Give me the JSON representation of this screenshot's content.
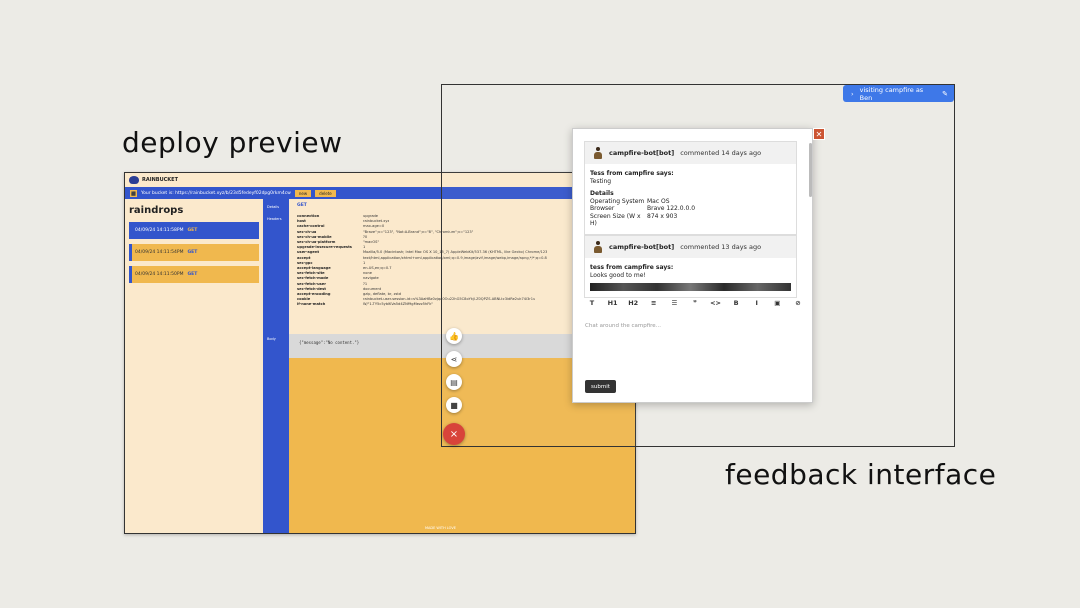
{
  "captions": {
    "deploy": "deploy preview",
    "feedback": "feedback interface"
  },
  "deploy": {
    "brand": "RAINBUCKET",
    "bucket_text": "Your bucket is: https://rainbucket.xyz/b/23d5fedeyf02dpg0rkm4cw",
    "buttons": [
      "new",
      "delete"
    ],
    "title": "raindrops",
    "requests": [
      {
        "time": "04/09/24 14:11:58PM",
        "method": "GET",
        "selected": true
      },
      {
        "time": "04/09/24 14:11:54PM",
        "method": "GET",
        "selected": false
      },
      {
        "time": "04/09/24 14:11:50PM",
        "method": "GET",
        "selected": false
      }
    ],
    "labels": {
      "details": "Details",
      "headers": "Headers",
      "body": "Body"
    },
    "method": "GET",
    "headers": [
      {
        "k": "connection",
        "v": "upgrade"
      },
      {
        "k": "host",
        "v": "rainbucket.xyz"
      },
      {
        "k": "cache-control",
        "v": "max-age=0"
      },
      {
        "k": "sec-ch-ua",
        "v": "\"Brave\";v=\"123\", \"Not:A-Brand\";v=\"8\", \"Chromium\";v=\"123\""
      },
      {
        "k": "sec-ch-ua-mobile",
        "v": "?0"
      },
      {
        "k": "sec-ch-ua-platform",
        "v": "\"macOS\""
      },
      {
        "k": "upgrade-insecure-requests",
        "v": "1"
      },
      {
        "k": "user-agent",
        "v": "Mozilla/5.0 (Macintosh; Intel Mac OS X 10_15_7) AppleWebKit/537.36 (KHTML, like Gecko) Chrome/123"
      },
      {
        "k": "accept",
        "v": "text/html,application/xhtml+xml,application/xml;q=0.9,image/avif,image/webp,image/apng,*/*;q=0.8"
      },
      {
        "k": "sec-gpc",
        "v": "1"
      },
      {
        "k": "accept-language",
        "v": "en-US,en;q=0.7"
      },
      {
        "k": "sec-fetch-site",
        "v": "none"
      },
      {
        "k": "sec-fetch-mode",
        "v": "navigate"
      },
      {
        "k": "sec-fetch-user",
        "v": "?1"
      },
      {
        "k": "sec-fetch-dest",
        "v": "document"
      },
      {
        "k": "accept-encoding",
        "v": "gzip, deflate, br, zstd"
      },
      {
        "k": "cookie",
        "v": "rainbucket-user-session-id=s%3AaHBz0vjqa0Ou22hG5C8oYkjl.Z0QPZS.ABNLtc3idRe2uk74i3r1u"
      },
      {
        "k": "if-none-match",
        "v": "W/\"1-TY5c5yblKVa5d4ZNf9gMezz5hFk\""
      }
    ],
    "body": "{\"message\":\"No content.\"}",
    "footer": "MADE WITH LOVE"
  },
  "feedback": {
    "visiting": "visiting campfire as Ben",
    "comments": [
      {
        "author": "campfire-bot[bot]",
        "when": "commented 14 days ago",
        "says": "Tess from campfire says:",
        "text": "Testing",
        "details_title": "Details",
        "details": [
          {
            "k": "Operating System",
            "v": "Mac OS"
          },
          {
            "k": "Browser",
            "v": "Brave 122.0.0.0"
          },
          {
            "k": "Screen Size (W x H)",
            "v": "874 x 903"
          }
        ]
      },
      {
        "author": "campfire-bot[bot]",
        "when": "commented 13 days ago",
        "says": "tess from campfire says:",
        "text": "Looks good to me!"
      }
    ],
    "toolbar": [
      "T",
      "H1",
      "H2",
      "≡",
      "☰",
      "❞",
      "<>",
      "B",
      "I",
      "▣",
      "⊘"
    ],
    "chat_placeholder": "Chat around the campfire...",
    "submit": "submit"
  }
}
